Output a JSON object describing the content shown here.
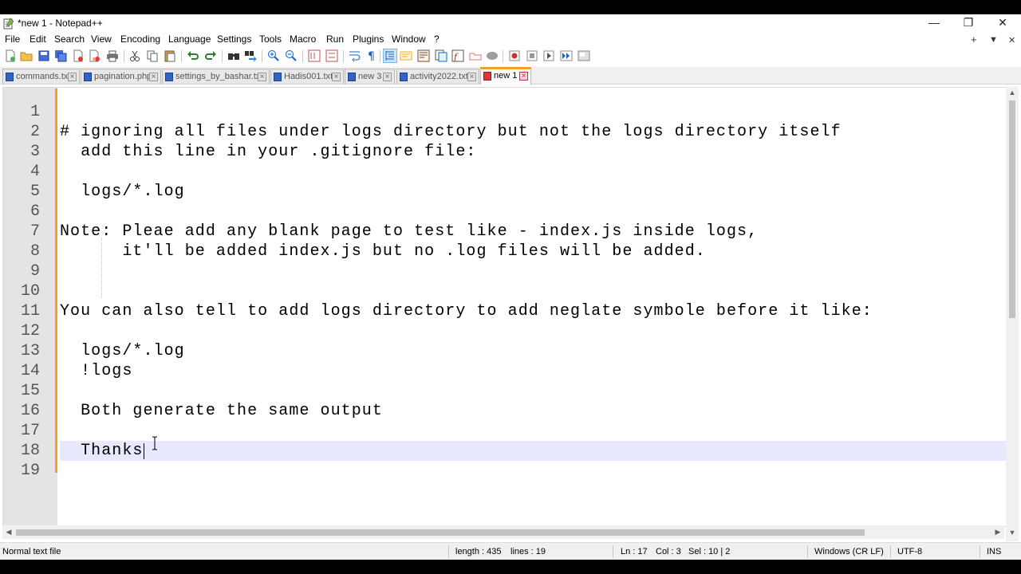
{
  "window": {
    "title": "*new 1 - Notepad++",
    "controls": {
      "minimize": "—",
      "restore": "❐",
      "close": "✕"
    }
  },
  "menu": {
    "items": [
      "File",
      "Edit",
      "Search",
      "View",
      "Encoding",
      "Language",
      "Settings",
      "Tools",
      "Macro",
      "Run",
      "Plugins",
      "Window",
      "?"
    ],
    "right": {
      "add": "+",
      "dropdown": "▼",
      "close": "✕"
    }
  },
  "toolbar": {
    "icons": [
      "new-file-icon",
      "open-file-icon",
      "save-icon",
      "save-all-icon",
      "close-icon",
      "close-all-icon",
      "print-icon",
      "cut-icon",
      "copy-icon",
      "paste-icon",
      "undo-icon",
      "redo-icon",
      "find-icon",
      "replace-icon",
      "zoom-in-icon",
      "zoom-out-icon",
      "sync-vertical-icon",
      "sync-horizontal-icon",
      "word-wrap-icon",
      "show-all-chars-icon",
      "indent-guide-icon",
      "language-udl-icon",
      "doc-map-icon",
      "doc-list-icon",
      "function-list-icon",
      "folder-workspace-icon",
      "monitoring-icon",
      "record-macro-icon",
      "stop-macro-icon",
      "play-macro-icon",
      "run-macro-multiple-icon",
      "save-macro-icon"
    ]
  },
  "tabs": [
    {
      "label": "commands.txt",
      "active": false
    },
    {
      "label": "pagination.php",
      "active": false
    },
    {
      "label": "settings_by_bashar.txt",
      "active": false
    },
    {
      "label": "Hadis001.txt",
      "active": false
    },
    {
      "label": "new 3",
      "active": false
    },
    {
      "label": "activity2022.txt",
      "active": false
    },
    {
      "label": "new 1",
      "active": true
    }
  ],
  "editor": {
    "lines": [
      "",
      "# ignoring all files under logs directory but not the logs directory itself",
      "  add this line in your .gitignore file:",
      "",
      "  logs/*.log",
      "",
      "Note: Pleae add any blank page to test like - index.js inside logs,",
      "      it'll be added index.js but no .log files will be added.",
      "",
      "",
      "You can also tell to add logs directory to add neglate symbole before it like:",
      "",
      "  logs/*.log",
      "  !logs",
      "",
      "  Both generate the same output",
      "",
      "  Thanks",
      ""
    ],
    "line_numbers": [
      "1",
      "2",
      "3",
      "4",
      "5",
      "6",
      "7",
      "8",
      "9",
      "10",
      "11",
      "12",
      "13",
      "14",
      "15",
      "16",
      "17",
      "18",
      "19"
    ],
    "current_line": 18
  },
  "status": {
    "file_type": "Normal text file",
    "length": "length : 435",
    "lines": "lines : 19",
    "ln": "Ln : 17",
    "col": "Col : 3",
    "sel": "Sel : 10 | 2",
    "eol": "Windows (CR LF)",
    "encoding": "UTF-8",
    "mode": "INS"
  }
}
